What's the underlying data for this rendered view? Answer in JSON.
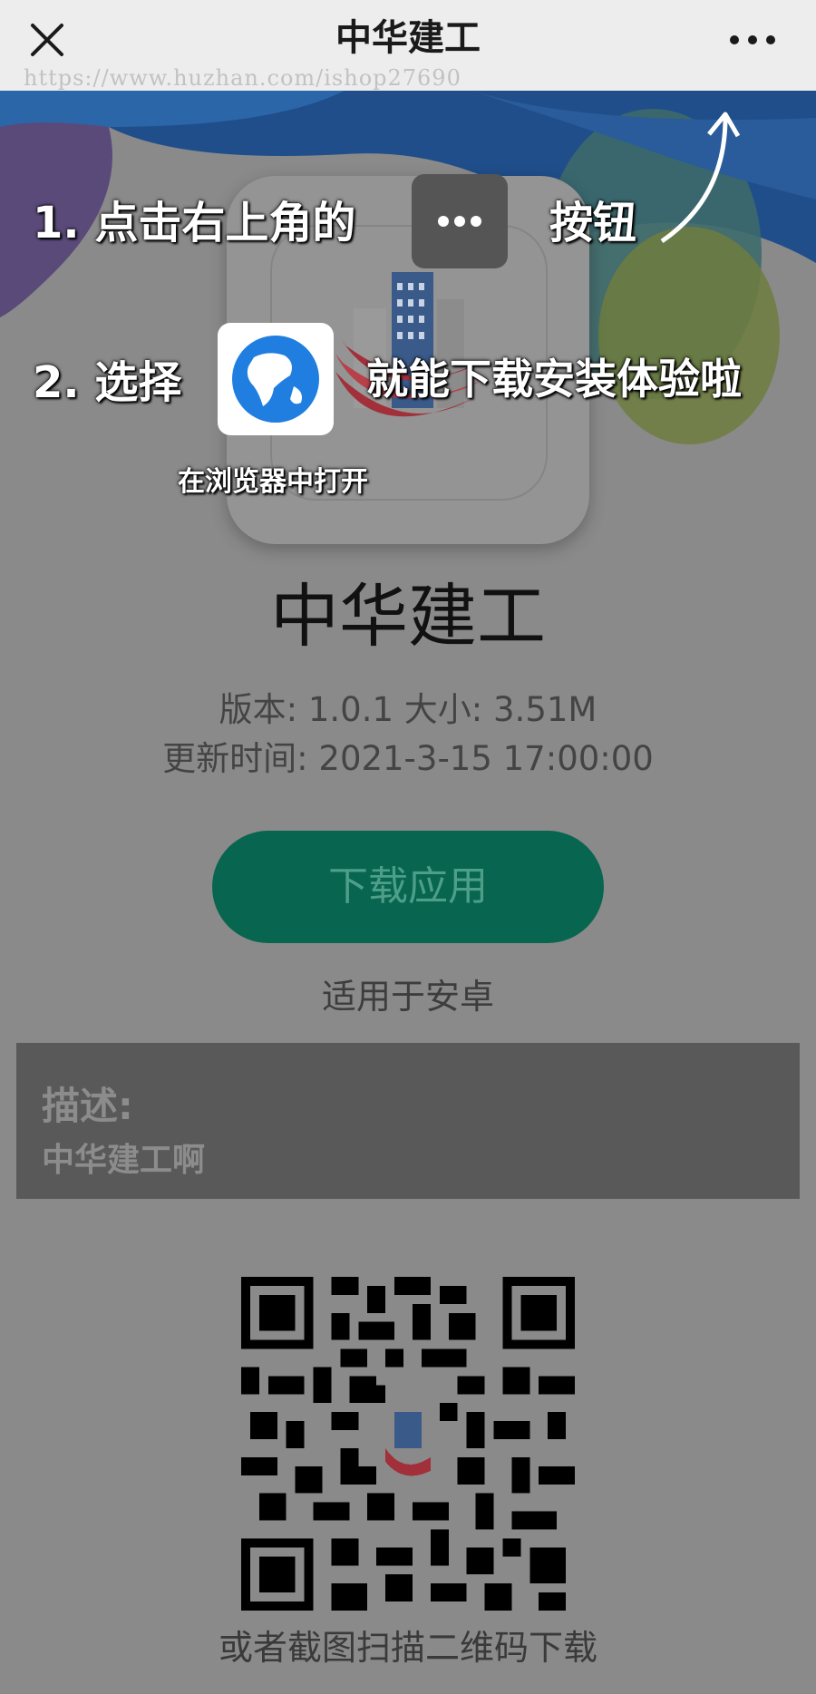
{
  "navbar": {
    "title": "中华建工",
    "close_icon": "close-icon",
    "more_icon": "more-icon",
    "watermark": "https://www.huzhan.com/ishop27690"
  },
  "tips": {
    "step1_prefix": "1. 点击右上角的",
    "step1_suffix": "按钮",
    "step2_prefix": "2. 选择",
    "step2_suffix": "就能下载安装体验啦",
    "browser_label": "在浏览器中打开"
  },
  "app": {
    "name": "中华建工",
    "version_size": "版本: 1.0.1 大小: 3.51M",
    "update_time": "更新时间: 2021-3-15 17:00:00",
    "download_label": "下载应用",
    "platform_note": "适用于安卓"
  },
  "description": {
    "title": "描述:",
    "text": "中华建工啊"
  },
  "qr": {
    "caption": "或者截图扫描二维码下载"
  },
  "colors": {
    "download_button": "#08654f",
    "overlay": "#8a8a8a",
    "description_box": "#595959"
  }
}
